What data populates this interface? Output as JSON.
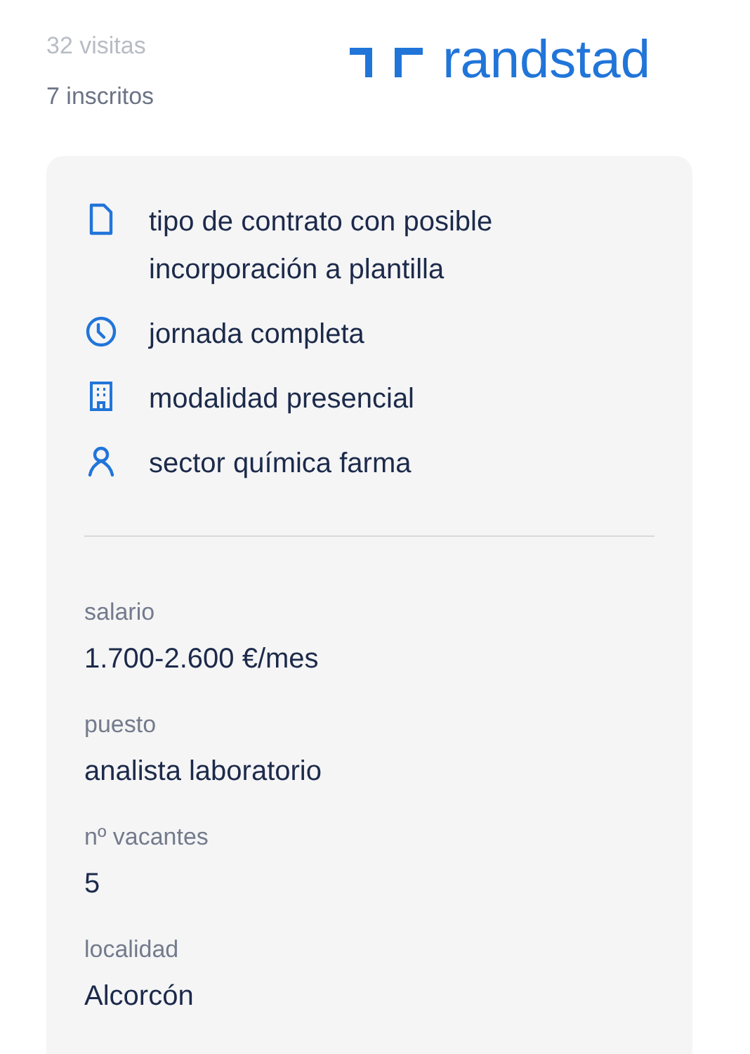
{
  "stats": {
    "visits": "32 visitas",
    "applicants": "7 inscritos"
  },
  "logo": {
    "text": "randstad"
  },
  "features": [
    {
      "kind": "document",
      "text": "tipo de contrato con posible incorporación a plantilla"
    },
    {
      "kind": "clock",
      "text": "jornada completa"
    },
    {
      "kind": "building",
      "text": "modalidad presencial"
    },
    {
      "kind": "person",
      "text": "sector química farma"
    }
  ],
  "details": [
    {
      "label": "salario",
      "value": "1.700-2.600 €/mes"
    },
    {
      "label": "puesto",
      "value": "analista laboratorio"
    },
    {
      "label": "nº vacantes",
      "value": "5"
    },
    {
      "label": "localidad",
      "value": "Alcorcón"
    }
  ]
}
